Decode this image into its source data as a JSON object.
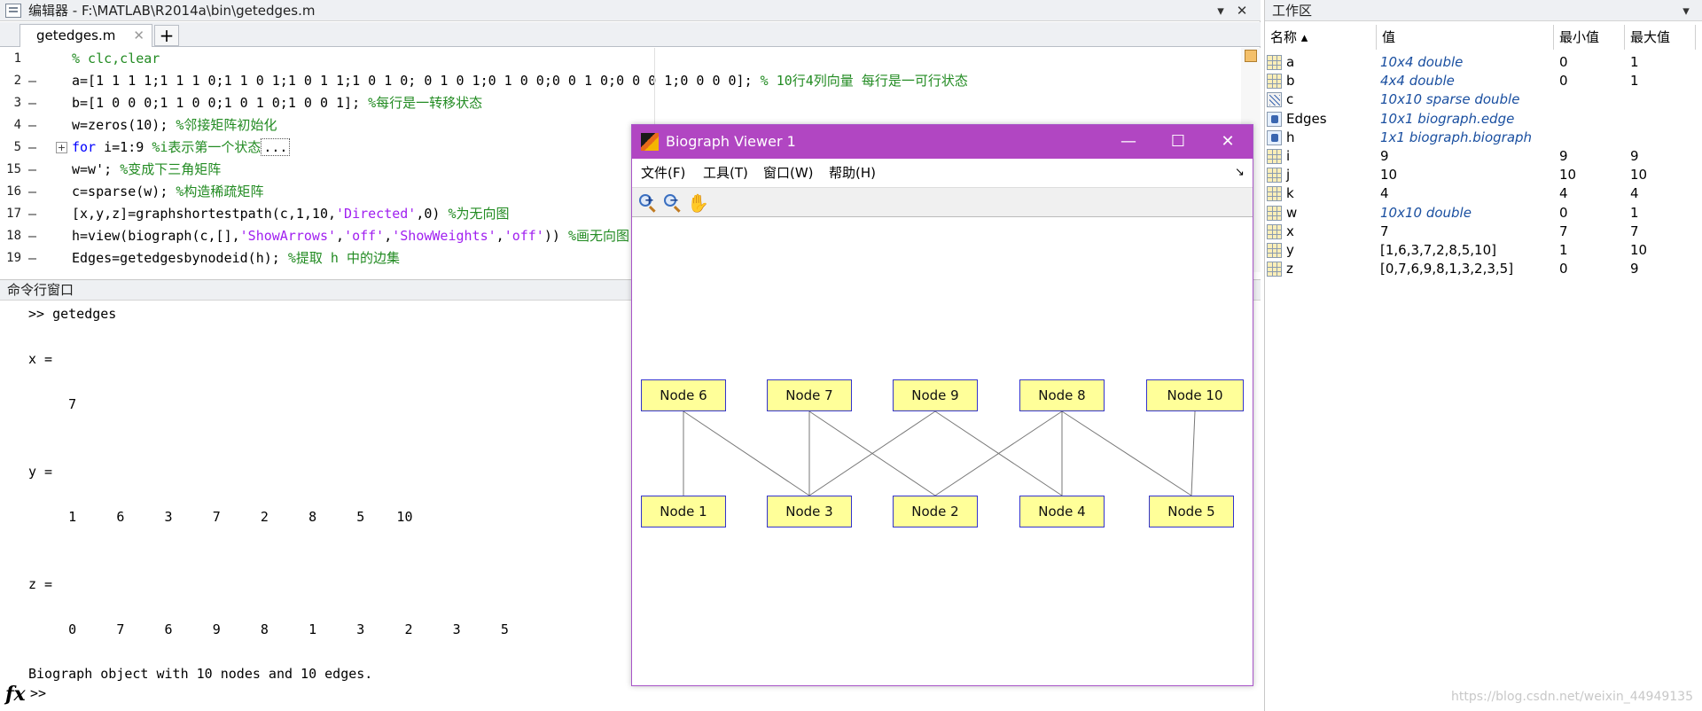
{
  "editor": {
    "title": "编辑器 - F:\\MATLAB\\R2014a\\bin\\getedges.m",
    "tab_label": "getedges.m",
    "tab_close": "✕",
    "tab_add": "+",
    "btn_menu": "▾",
    "btn_close": "✕",
    "lines": [
      {
        "num": "1",
        "dash": "",
        "parts": [
          {
            "t": "% clc,clear",
            "c": "cmt"
          }
        ]
      },
      {
        "num": "2",
        "dash": "–",
        "parts": [
          {
            "t": "a=[1 1 1 1;1 1 1 0;1 1 0 1;1 0 1 1;1 0 1 0; 0 1 0 1;0 1 0 0;0 0 1 0;0 0 0 1;0 0 0 0]; ",
            "c": ""
          },
          {
            "t": "% 10行4列向量 每行是一可行状态",
            "c": "cmt"
          }
        ]
      },
      {
        "num": "3",
        "dash": "–",
        "parts": [
          {
            "t": "b=[1 0 0 0;1 1 0 0;1 0 1 0;1 0 0 1]; ",
            "c": ""
          },
          {
            "t": "%每行是一转移状态",
            "c": "cmt"
          }
        ]
      },
      {
        "num": "4",
        "dash": "–",
        "parts": [
          {
            "t": "w=zeros(10); ",
            "c": ""
          },
          {
            "t": "%邻接矩阵初始化",
            "c": "cmt"
          }
        ]
      },
      {
        "num": "5",
        "dash": "–",
        "fold": "+",
        "parts": [
          {
            "t": "for",
            "c": "kw"
          },
          {
            "t": " i=1:9 ",
            "c": ""
          },
          {
            "t": "%i表示第一个状态",
            "c": "cmt"
          },
          {
            "t": "...",
            "c": "ell"
          }
        ]
      },
      {
        "num": "15",
        "dash": "–",
        "parts": [
          {
            "t": "w=w'; ",
            "c": ""
          },
          {
            "t": "%变成下三角矩阵",
            "c": "cmt"
          }
        ]
      },
      {
        "num": "16",
        "dash": "–",
        "parts": [
          {
            "t": "c=sparse(w); ",
            "c": ""
          },
          {
            "t": "%构造稀疏矩阵",
            "c": "cmt"
          }
        ]
      },
      {
        "num": "17",
        "dash": "–",
        "parts": [
          {
            "t": "[x,y,z]=graphshortestpath(c,1,10,",
            "c": ""
          },
          {
            "t": "'Directed'",
            "c": "str"
          },
          {
            "t": ",0) ",
            "c": ""
          },
          {
            "t": "%为无向图",
            "c": "cmt"
          }
        ]
      },
      {
        "num": "18",
        "dash": "–",
        "parts": [
          {
            "t": "h=view(biograph(c,[],",
            "c": ""
          },
          {
            "t": "'ShowArrows'",
            "c": "str"
          },
          {
            "t": ",",
            "c": ""
          },
          {
            "t": "'off'",
            "c": "str"
          },
          {
            "t": ",",
            "c": ""
          },
          {
            "t": "'ShowWeights'",
            "c": "str"
          },
          {
            "t": ",",
            "c": ""
          },
          {
            "t": "'off'",
            "c": "str"
          },
          {
            "t": ")) ",
            "c": ""
          },
          {
            "t": "%画无向图",
            "c": "cmt"
          }
        ]
      },
      {
        "num": "19",
        "dash": "–",
        "parts": [
          {
            "t": "Edges=getedgesbynodeid(h); ",
            "c": ""
          },
          {
            "t": "%提取 h 中的边集",
            "c": "cmt"
          }
        ]
      }
    ]
  },
  "command": {
    "title": "命令行窗口",
    "lines": [
      ">> getedges",
      "",
      "x =",
      "",
      "     7",
      "",
      "",
      "y =",
      "",
      "     1     6     3     7     2     8     5    10",
      "",
      "",
      "z =",
      "",
      "     0     7     6     9     8     1     3     2     3     5",
      "",
      "Biograph object with 10 nodes and 10 edges."
    ],
    "fx": "fx",
    "prompt": ">>"
  },
  "workspace": {
    "title": "工作区",
    "btn_menu": "▾",
    "headers": {
      "name": "名称 ▴",
      "value": "值",
      "min": "最小值",
      "max": "最大值"
    },
    "rows": [
      {
        "icon": "grid",
        "name": "a",
        "value": "10x4 double",
        "obj": true,
        "min": "0",
        "max": "1"
      },
      {
        "icon": "grid",
        "name": "b",
        "value": "4x4 double",
        "obj": true,
        "min": "0",
        "max": "1"
      },
      {
        "icon": "sparse",
        "name": "c",
        "value": "10x10 sparse double",
        "obj": true,
        "min": "",
        "max": ""
      },
      {
        "icon": "obj",
        "name": "Edges",
        "value": "10x1 biograph.edge",
        "obj": true,
        "min": "",
        "max": ""
      },
      {
        "icon": "obj",
        "name": "h",
        "value": "1x1 biograph.biograph",
        "obj": true,
        "min": "",
        "max": ""
      },
      {
        "icon": "grid",
        "name": "i",
        "value": "9",
        "obj": false,
        "min": "9",
        "max": "9"
      },
      {
        "icon": "grid",
        "name": "j",
        "value": "10",
        "obj": false,
        "min": "10",
        "max": "10"
      },
      {
        "icon": "grid",
        "name": "k",
        "value": "4",
        "obj": false,
        "min": "4",
        "max": "4"
      },
      {
        "icon": "grid",
        "name": "w",
        "value": "10x10 double",
        "obj": true,
        "min": "0",
        "max": "1"
      },
      {
        "icon": "grid",
        "name": "x",
        "value": "7",
        "obj": false,
        "min": "7",
        "max": "7"
      },
      {
        "icon": "grid",
        "name": "y",
        "value": "[1,6,3,7,2,8,5,10]",
        "obj": false,
        "min": "1",
        "max": "10"
      },
      {
        "icon": "grid",
        "name": "z",
        "value": "[0,7,6,9,8,1,3,2,3,5]",
        "obj": false,
        "min": "0",
        "max": "9"
      }
    ]
  },
  "biograph": {
    "title": "Biograph Viewer 1",
    "btn_min": "—",
    "btn_max": "☐",
    "btn_close": "✕",
    "menu": [
      "文件(F)",
      "工具(T)",
      "窗口(W)",
      "帮助(H)"
    ],
    "menu_arrow": "↘",
    "tools": [
      "zoom-in-icon",
      "zoom-out-icon",
      "pan-hand-icon"
    ],
    "nodes": [
      {
        "id": "6",
        "label": "Node 6"
      },
      {
        "id": "7",
        "label": "Node 7"
      },
      {
        "id": "9",
        "label": "Node 9"
      },
      {
        "id": "8",
        "label": "Node 8"
      },
      {
        "id": "10",
        "label": "Node 10"
      },
      {
        "id": "1",
        "label": "Node 1"
      },
      {
        "id": "3",
        "label": "Node 3"
      },
      {
        "id": "2",
        "label": "Node 2"
      },
      {
        "id": "4",
        "label": "Node 4"
      },
      {
        "id": "5",
        "label": "Node 5"
      }
    ],
    "edges": [
      [
        "1",
        "6"
      ],
      [
        "3",
        "6"
      ],
      [
        "3",
        "7"
      ],
      [
        "3",
        "9"
      ],
      [
        "2",
        "7"
      ],
      [
        "2",
        "8"
      ],
      [
        "4",
        "9"
      ],
      [
        "4",
        "8"
      ],
      [
        "5",
        "8"
      ],
      [
        "5",
        "10"
      ]
    ],
    "colors": {
      "title_bar": "#b146c2",
      "node_fill": "#ffff99",
      "node_border": "#3333cc",
      "edge": "#777777"
    }
  },
  "watermark": "https://blog.csdn.net/weixin_44949135"
}
